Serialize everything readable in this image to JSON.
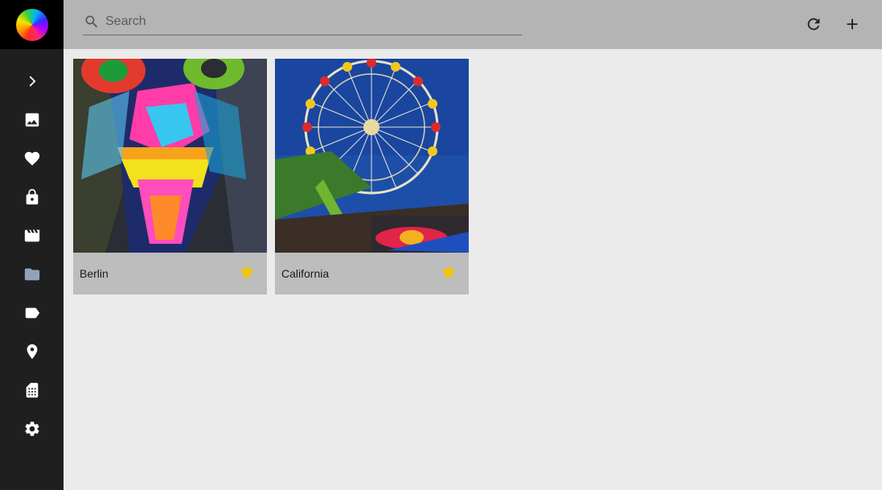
{
  "search": {
    "placeholder": "Search"
  },
  "sidebar": {
    "items": [
      {
        "name": "expand",
        "icon": "chevron-right-icon"
      },
      {
        "name": "photos",
        "icon": "image-icon"
      },
      {
        "name": "favorites",
        "icon": "heart-icon"
      },
      {
        "name": "private",
        "icon": "lock-icon"
      },
      {
        "name": "videos",
        "icon": "movie-icon"
      },
      {
        "name": "albums",
        "icon": "folder-icon"
      },
      {
        "name": "labels",
        "icon": "label-icon"
      },
      {
        "name": "places",
        "icon": "place-icon"
      },
      {
        "name": "library",
        "icon": "film-library-icon"
      },
      {
        "name": "settings",
        "icon": "gear-icon"
      }
    ]
  },
  "toolbar": {
    "refresh_icon": "refresh-icon",
    "add_icon": "plus-icon"
  },
  "albums": [
    {
      "title": "Berlin",
      "favorite": true
    },
    {
      "title": "California",
      "favorite": true
    }
  ],
  "colors": {
    "sidebar_bg": "#1f1f1f",
    "topbar_bg": "#b4b4b4",
    "page_bg": "#ebebeb",
    "card_footer_bg": "#bdbdbd",
    "star": "#f5c400",
    "folder_icon": "#8fa3b8"
  }
}
